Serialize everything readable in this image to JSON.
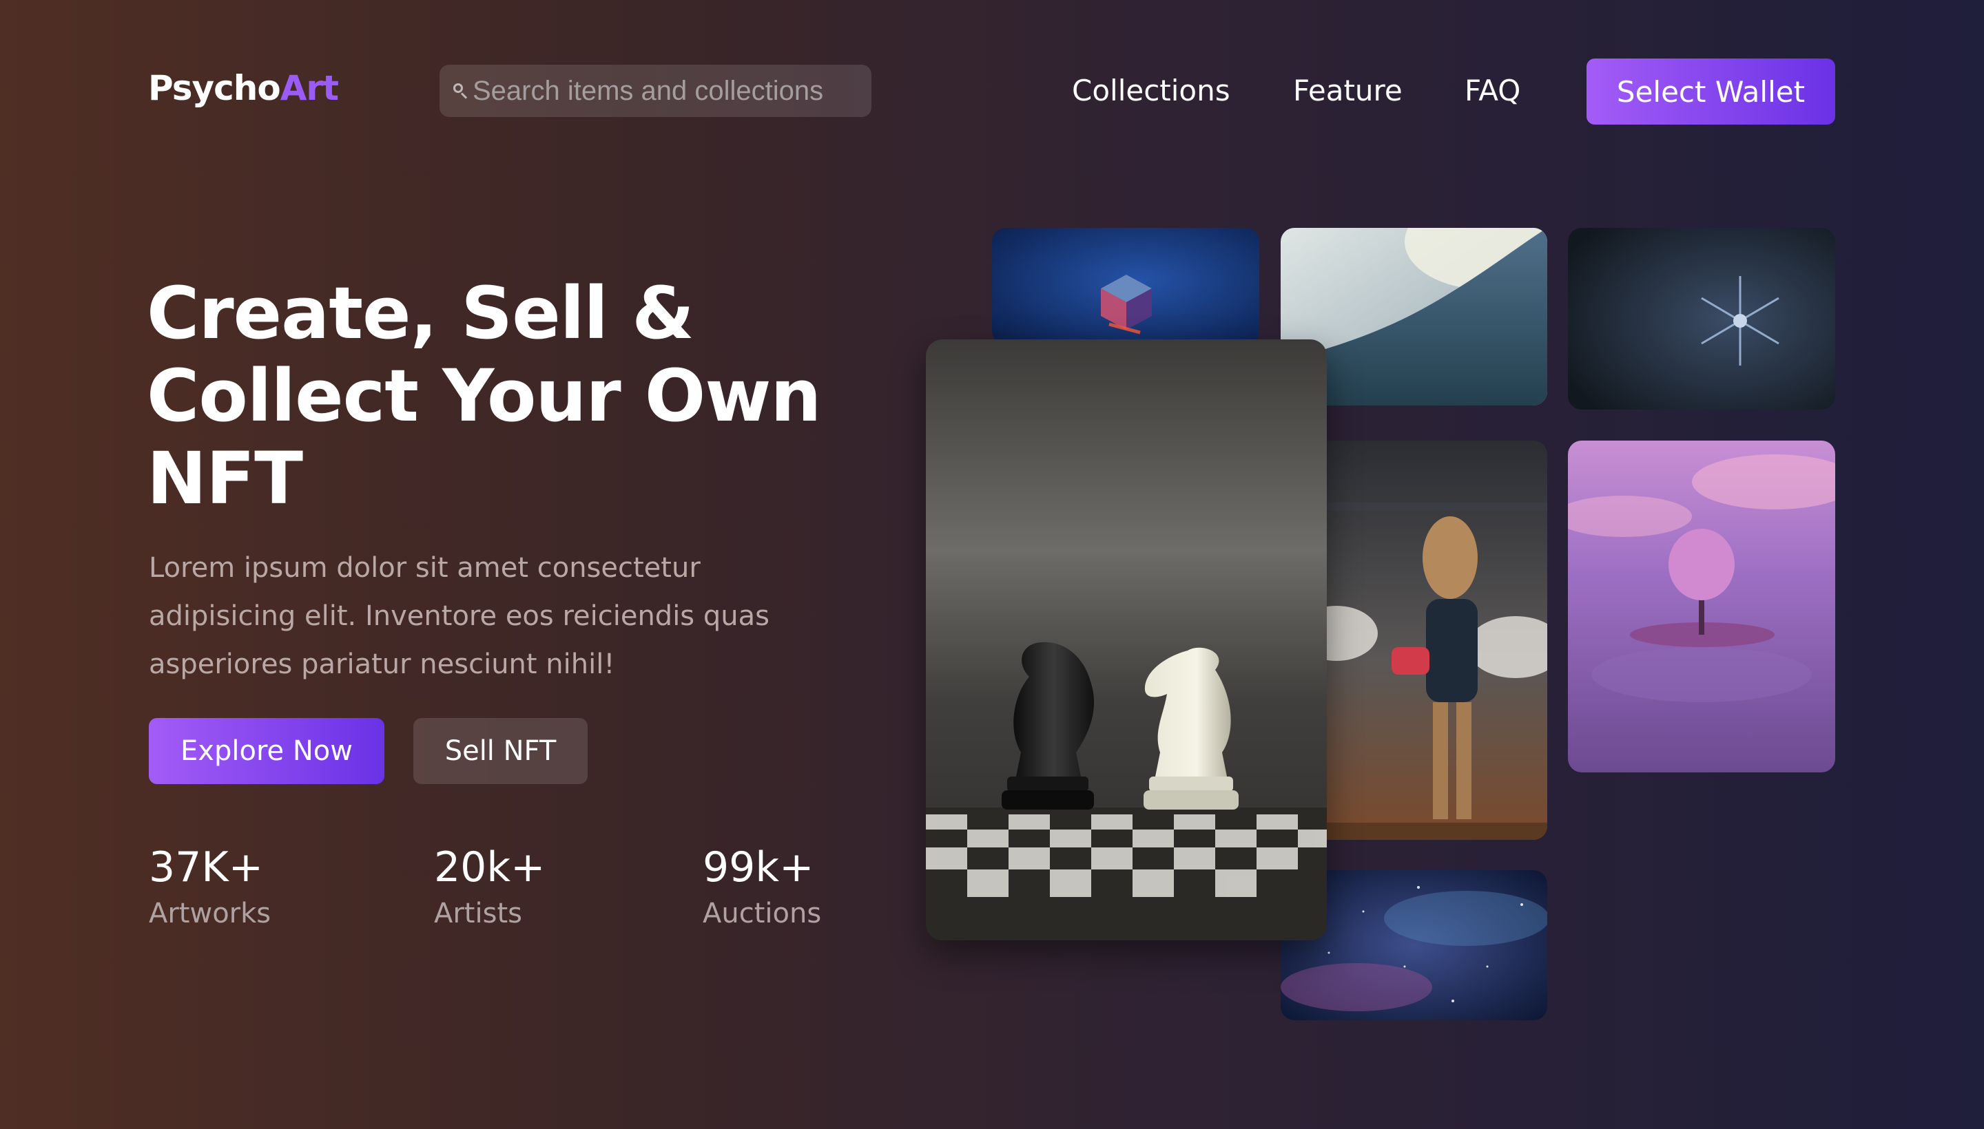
{
  "header": {
    "logo_part1": "Psycho",
    "logo_part2": "Art",
    "search_placeholder": "Search items and collections",
    "nav": [
      "Collections",
      "Feature",
      "FAQ"
    ],
    "cta": "Select Wallet"
  },
  "hero": {
    "title": "Create, Sell & Collect Your Own NFT",
    "description": "Lorem ipsum dolor sit amet consectetur adipisicing elit. Inventore eos reiciendis quas asperiores pariatur nesciunt nihil!",
    "primary_button": "Explore Now",
    "secondary_button": "Sell NFT",
    "stats": [
      {
        "value": "37K+",
        "label": "Artworks"
      },
      {
        "value": "20k+",
        "label": "Artists"
      },
      {
        "value": "99k+",
        "label": "Auctions"
      }
    ]
  },
  "colors": {
    "accent": "#9b5cf5",
    "accent_dark": "#6a32e6",
    "bg_left": "#4f2e24",
    "bg_right": "#1f1e3b"
  }
}
